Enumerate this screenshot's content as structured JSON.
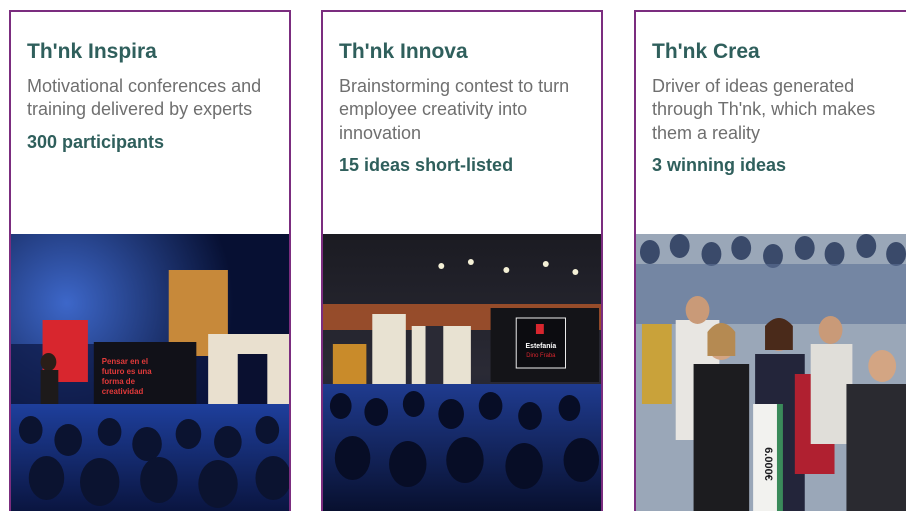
{
  "cards": [
    {
      "title": "Th'nk Inspira",
      "description": "Motivational conferences and training delivered by experts",
      "stat": "300 participants",
      "image": {
        "screen_text": "Pensar en el futuro es una forma de creatividad"
      }
    },
    {
      "title": "Th'nk Innova",
      "description": "Brainstorming contest to turn employee creativity into innovation",
      "stat": "15 ideas short-listed",
      "image": {
        "screen_name": "Estefanía",
        "screen_sub": "Dino Fraba"
      }
    },
    {
      "title": "Th'nk Crea",
      "description": "Driver of ideas generated through Th'nk, which makes them a reality",
      "stat": "3 winning ideas",
      "image": {
        "cheque_amount": "6.000€"
      }
    }
  ],
  "colors": {
    "border": "#7b2d7f",
    "title": "#2f5f5c",
    "text": "#6f6f6f"
  }
}
